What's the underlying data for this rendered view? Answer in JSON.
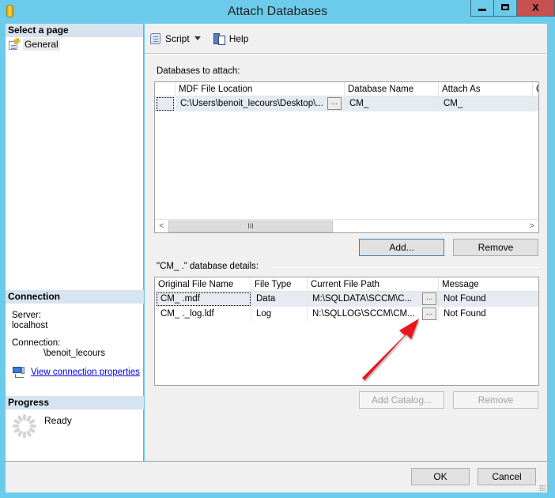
{
  "window": {
    "title": "Attach Databases",
    "controls": {
      "minimize": "minimize",
      "maximize": "maximize",
      "close": "X"
    }
  },
  "left_panel": {
    "select_page_header": "Select a page",
    "pages": [
      {
        "label": "General",
        "icon": "general-page-icon"
      }
    ],
    "connection": {
      "header": "Connection",
      "server_label": "Server:",
      "server_value": "localhost",
      "connection_label": "Connection:",
      "connection_value": "\\benoit_lecours",
      "link": "View connection properties"
    },
    "progress": {
      "header": "Progress",
      "status": "Ready"
    }
  },
  "toolbar": {
    "script_label": "Script",
    "help_label": "Help"
  },
  "databases_to_attach": {
    "label": "Databases to attach:",
    "columns": [
      "",
      "MDF File Location",
      "Database Name",
      "Attach As",
      "O"
    ],
    "rows": [
      {
        "mdf_location": "C:\\Users\\benoit_lecours\\Desktop\\...",
        "browse": "...",
        "database_name": "CM_",
        "attach_as": "CM_",
        "extra": ","
      }
    ],
    "scrollbar": {
      "left": "<",
      "thumb": "III",
      "right": ">"
    },
    "add_button": "Add...",
    "remove_button": "Remove"
  },
  "details": {
    "label": "\"CM_      .\" database details:",
    "columns": [
      "Original File Name",
      "File Type",
      "Current File Path",
      "",
      "Message"
    ],
    "rows": [
      {
        "original": "CM_       .mdf",
        "type": "Data",
        "path": "M:\\SQLDATA\\SCCM\\C...",
        "browse": "...",
        "message": "Not Found"
      },
      {
        "original": "CM_       ._log.ldf",
        "type": "Log",
        "path": "N:\\SQLLOG\\SCCM\\CM...",
        "browse": "...",
        "message": "Not Found"
      }
    ],
    "add_catalog_button": "Add Catalog...",
    "remove_button": "Remove"
  },
  "footer": {
    "ok_button": "OK",
    "cancel_button": "Cancel"
  },
  "annotation": {
    "arrow_color": "#e8161b"
  }
}
